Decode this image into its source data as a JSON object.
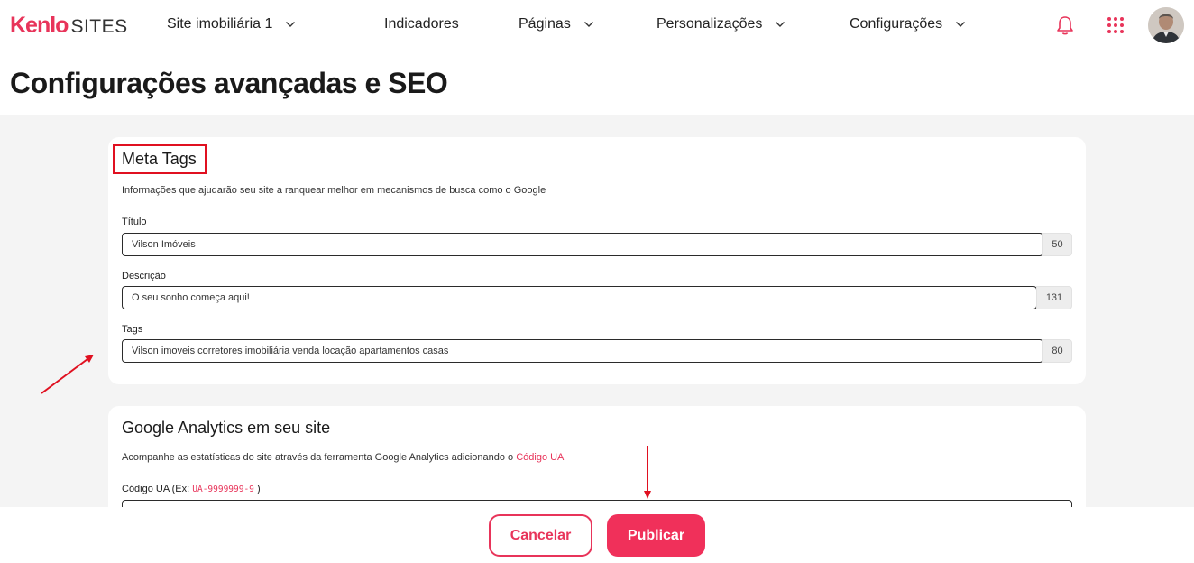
{
  "brand": {
    "kenlo": "Kenlo",
    "sites": "SITES",
    "accent": "#e8345a"
  },
  "nav": {
    "site_selector": "Site imobiliária 1",
    "indicadores": "Indicadores",
    "paginas": "Páginas",
    "personalizacoes": "Personalizações",
    "configuracoes": "Configurações"
  },
  "icons": {
    "bell": "bell-icon",
    "apps": "apps-grid-icon",
    "avatar": "user-avatar",
    "chevron": "chevron-down-icon"
  },
  "page": {
    "title": "Configurações avançadas e SEO"
  },
  "meta_tags": {
    "title": "Meta Tags",
    "description": "Informações que ajudarão seu site a ranquear melhor em mecanismos de busca como o Google",
    "fields": [
      {
        "label": "Título",
        "value": "Vilson Imóveis",
        "counter": "50"
      },
      {
        "label": "Descrição",
        "value": "O seu sonho começa aqui!",
        "counter": "131"
      },
      {
        "label": "Tags",
        "value": "Vilson imoveis corretores imobiliária venda locação apartamentos casas",
        "counter": "80"
      }
    ]
  },
  "analytics": {
    "title": "Google Analytics em seu site",
    "description": "Acompanhe as estatísticas do site através da ferramenta Google Analytics adicionando o",
    "link": "Código UA",
    "ua_label_prefix": "Código UA (Ex:",
    "ua_example": "UA-9999999-9",
    "ua_label_suffix": ")",
    "ua_value": ""
  },
  "footer": {
    "cancel": "Cancelar",
    "publish": "Publicar"
  }
}
